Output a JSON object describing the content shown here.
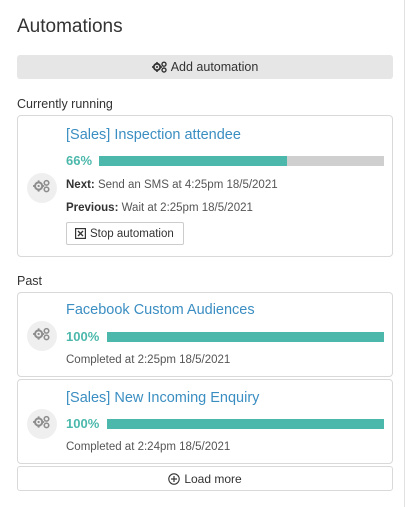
{
  "header": {
    "title": "Automations"
  },
  "toolbar": {
    "add_label": "Add automation",
    "add_icon": "gears-icon"
  },
  "running": {
    "section_label": "Currently running",
    "item": {
      "title": "[Sales] Inspection attendee",
      "progress_label": "66%",
      "progress": 0.66,
      "next_label": "Next:",
      "next_text": "Send an SMS at 4:25pm 18/5/2021",
      "previous_label": "Previous:",
      "previous_text": "Wait at 2:25pm 18/5/2021",
      "stop_label": "Stop automation"
    }
  },
  "past": {
    "section_label": "Past",
    "items": [
      {
        "title": "Facebook Custom Audiences",
        "progress_label": "100%",
        "progress": 1.0,
        "completed_text": "Completed at 2:25pm 18/5/2021"
      },
      {
        "title": "[Sales] New Incoming Enquiry",
        "progress_label": "100%",
        "progress": 1.0,
        "completed_text": "Completed at 2:24pm 18/5/2021"
      }
    ],
    "load_more_label": "Load more"
  },
  "colors": {
    "accent_teal": "#4bb8ab",
    "link_blue": "#3b8ec2",
    "track_grey": "#cfcfcf"
  }
}
